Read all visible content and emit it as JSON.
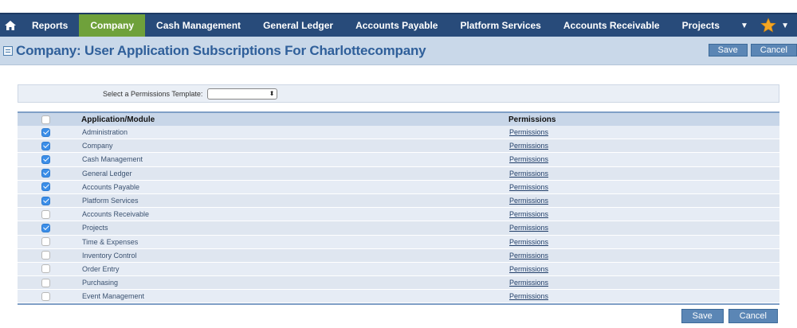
{
  "nav": {
    "items": [
      {
        "label": "Reports",
        "active": false
      },
      {
        "label": "Company",
        "active": true
      },
      {
        "label": "Cash Management",
        "active": false
      },
      {
        "label": "General Ledger",
        "active": false
      },
      {
        "label": "Accounts Payable",
        "active": false
      },
      {
        "label": "Platform Services",
        "active": false
      },
      {
        "label": "Accounts Receivable",
        "active": false
      },
      {
        "label": "Projects",
        "active": false
      }
    ],
    "icons": {
      "home": "home-icon",
      "more": "chevron-down-icon",
      "favorites": "star-icon"
    },
    "colors": {
      "bar": "#284b7a",
      "active": "#6fa13b",
      "star": "#f5a623"
    }
  },
  "page": {
    "title": "Company: User Application Subscriptions For Charlottecompany",
    "save_label": "Save",
    "cancel_label": "Cancel"
  },
  "template": {
    "label": "Select a Permissions Template:",
    "selected": ""
  },
  "table": {
    "headers": {
      "application": "Application/Module",
      "permissions": "Permissions"
    },
    "rows": [
      {
        "name": "Administration",
        "checked": true,
        "link": "Permissions"
      },
      {
        "name": "Company",
        "checked": true,
        "link": "Permissions"
      },
      {
        "name": "Cash Management",
        "checked": true,
        "link": "Permissions"
      },
      {
        "name": "General Ledger",
        "checked": true,
        "link": "Permissions"
      },
      {
        "name": "Accounts Payable",
        "checked": true,
        "link": "Permissions"
      },
      {
        "name": "Platform Services",
        "checked": true,
        "link": "Permissions"
      },
      {
        "name": "Accounts Receivable",
        "checked": false,
        "link": "Permissions"
      },
      {
        "name": "Projects",
        "checked": true,
        "link": "Permissions"
      },
      {
        "name": "Time & Expenses",
        "checked": false,
        "link": "Permissions"
      },
      {
        "name": "Inventory Control",
        "checked": false,
        "link": "Permissions"
      },
      {
        "name": "Order Entry",
        "checked": false,
        "link": "Permissions"
      },
      {
        "name": "Purchasing",
        "checked": false,
        "link": "Permissions"
      },
      {
        "name": "Event Management",
        "checked": false,
        "link": "Permissions"
      }
    ]
  },
  "footer": {
    "save_label": "Save",
    "cancel_label": "Cancel"
  }
}
